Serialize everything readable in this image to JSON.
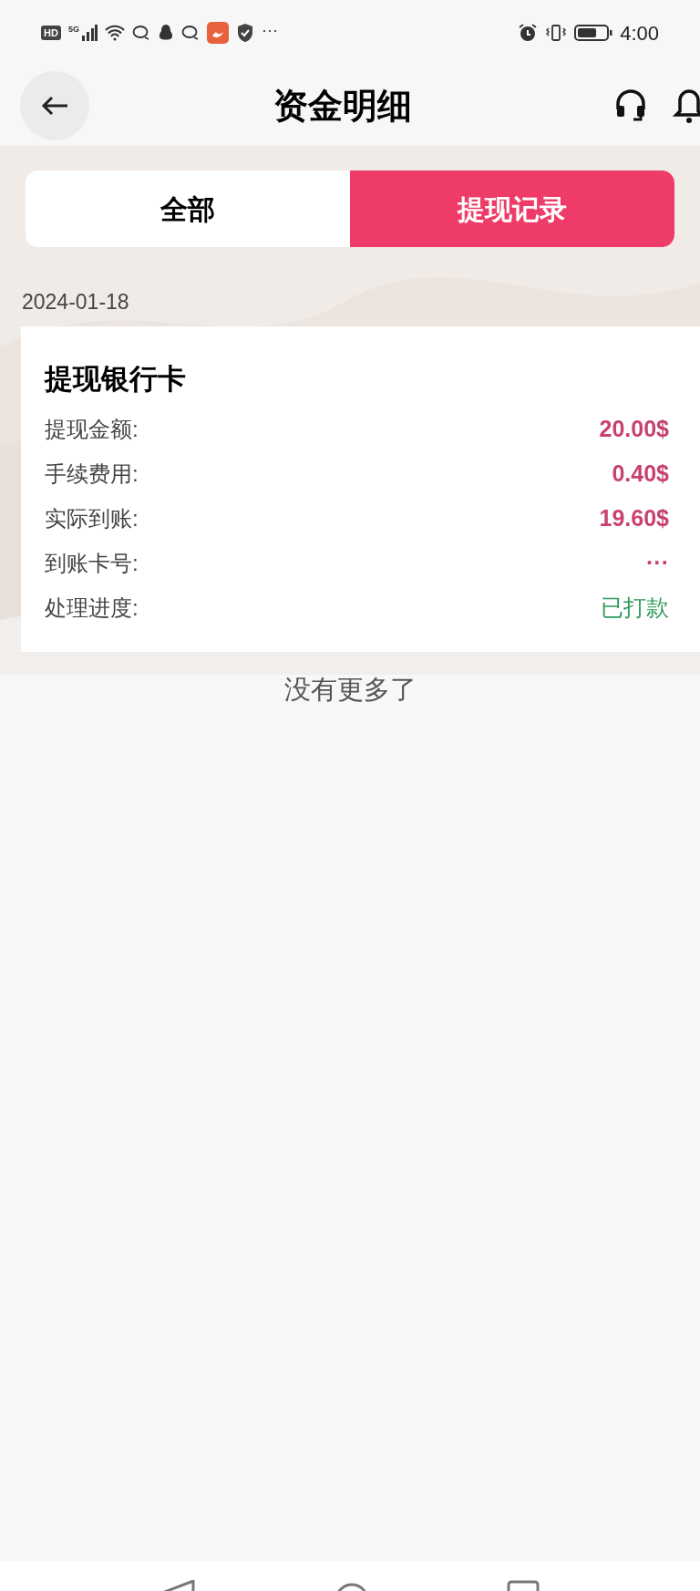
{
  "status_bar": {
    "badges": [
      "HD",
      "5G"
    ],
    "more": "···",
    "time": "4:00"
  },
  "header": {
    "title": "资金明细"
  },
  "tabs": [
    {
      "label": "全部",
      "selected": false
    },
    {
      "label": "提现记录",
      "selected": true
    }
  ],
  "date": "2024-01-18",
  "record": {
    "title": "提现银行卡",
    "rows": [
      {
        "label": "提现金额:",
        "value": "20.00$",
        "kind": "amount"
      },
      {
        "label": "手续费用:",
        "value": "0.40$",
        "kind": "amount"
      },
      {
        "label": "实际到账:",
        "value": "19.60$",
        "kind": "amount"
      },
      {
        "label": "到账卡号:",
        "value": "···",
        "kind": "amount"
      },
      {
        "label": "处理进度:",
        "value": "已打款",
        "kind": "status"
      }
    ]
  },
  "footer_note": "没有更多了"
}
